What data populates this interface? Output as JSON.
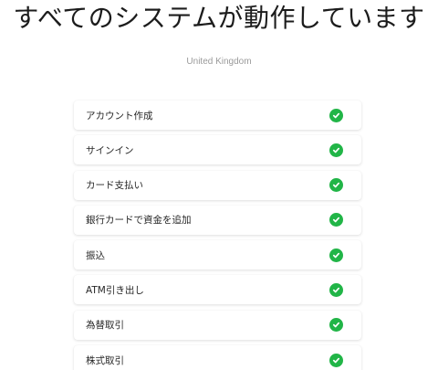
{
  "header": {
    "title": "すべてのシステムが動作しています",
    "region": "United Kingdom"
  },
  "colors": {
    "status_ok": "#21b547"
  },
  "services": [
    {
      "label": "アカウント作成",
      "status": "operational",
      "icon": "check-circle-icon"
    },
    {
      "label": "サインイン",
      "status": "operational",
      "icon": "check-circle-icon"
    },
    {
      "label": "カード支払い",
      "status": "operational",
      "icon": "check-circle-icon"
    },
    {
      "label": "銀行カードで資金を追加",
      "status": "operational",
      "icon": "check-circle-icon"
    },
    {
      "label": "振込",
      "status": "operational",
      "icon": "check-circle-icon"
    },
    {
      "label": "ATM引き出し",
      "status": "operational",
      "icon": "check-circle-icon"
    },
    {
      "label": "為替取引",
      "status": "operational",
      "icon": "check-circle-icon"
    },
    {
      "label": "株式取引",
      "status": "operational",
      "icon": "check-circle-icon"
    }
  ]
}
